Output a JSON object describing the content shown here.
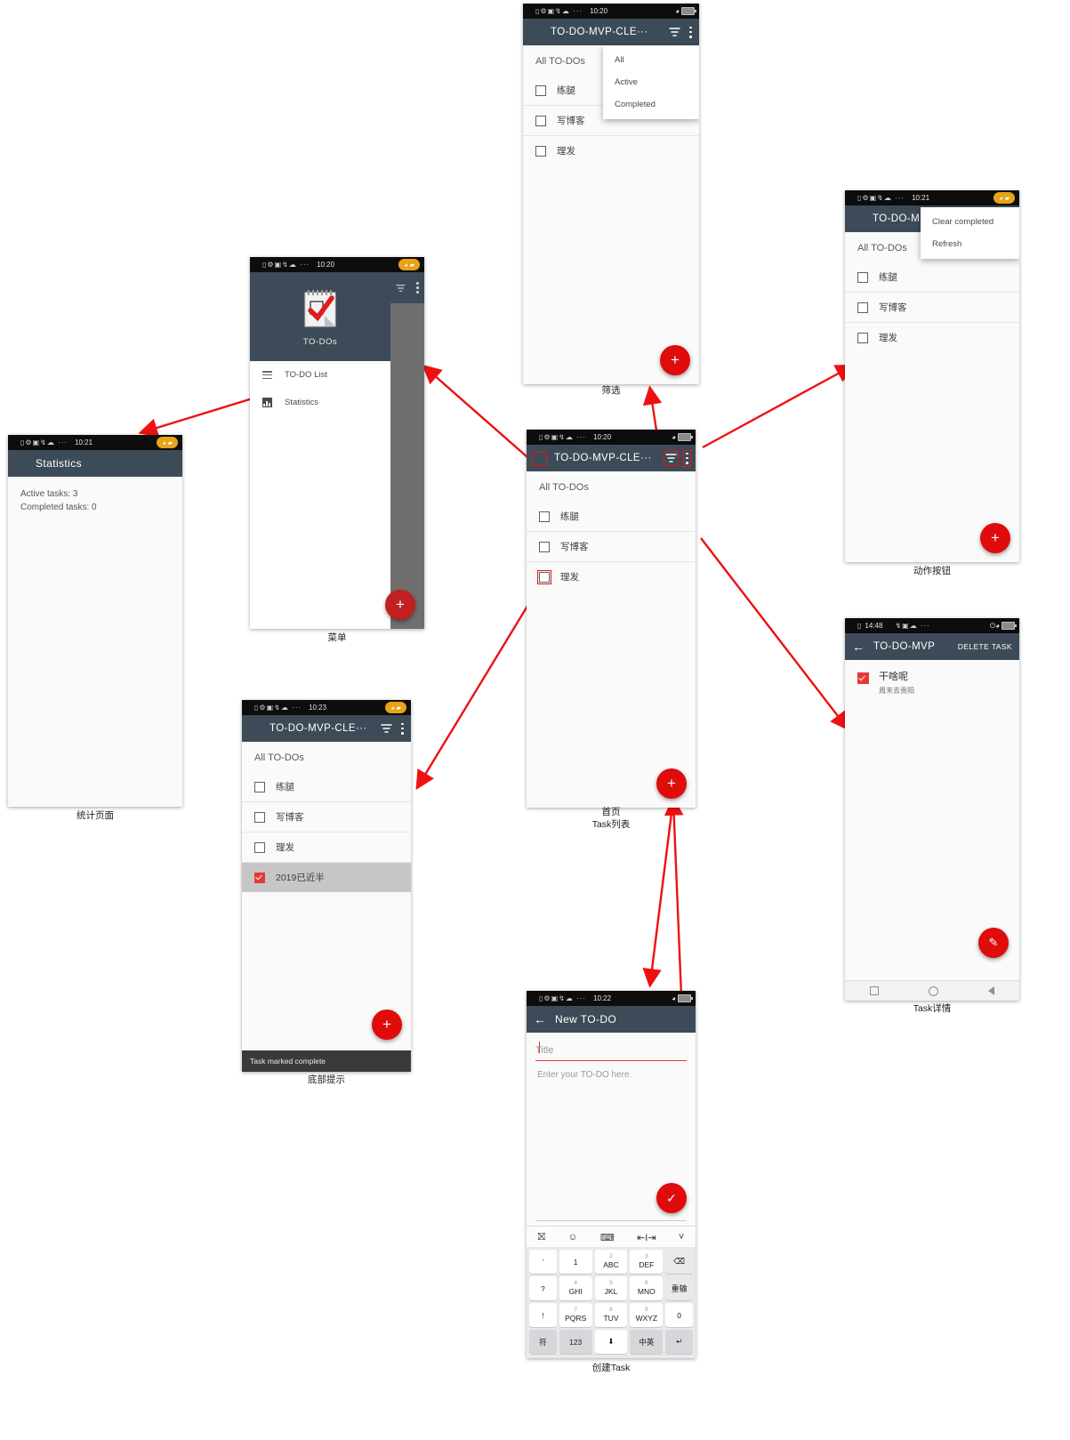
{
  "meta": {
    "accent_red": "#e00b0b",
    "appbar_color": "#3c4b57",
    "status_pill_color": "#e8a317"
  },
  "screens": {
    "filter": {
      "caption": "筛选",
      "status": {
        "time": "10:20"
      },
      "appbar": {
        "title": "TO-DO-MVP-CLE···",
        "menu_icon": "hamburger-icon",
        "filter_icon": "funnel-icon",
        "overflow_icon": "kebab-icon"
      },
      "section_title": "All TO-DOs",
      "tasks": [
        {
          "label": "练腿",
          "checked": false
        },
        {
          "label": "写博客",
          "checked": false
        },
        {
          "label": "理发",
          "checked": false
        }
      ],
      "popup": [
        "All",
        "Active",
        "Completed"
      ],
      "fab": "+"
    },
    "menu": {
      "caption": "菜单",
      "status": {
        "time": "10:20"
      },
      "drawer_label": "TO-DOs",
      "items": [
        {
          "label": "TO-DO List",
          "icon": "list-icon"
        },
        {
          "label": "Statistics",
          "icon": "bar-chart-icon"
        }
      ],
      "fab": "+"
    },
    "statistics": {
      "caption": "统计页面",
      "status": {
        "time": "10:21"
      },
      "appbar": {
        "title": "Statistics",
        "menu_icon": "hamburger-icon"
      },
      "lines": [
        "Active tasks: 3",
        "Completed tasks: 0"
      ]
    },
    "home": {
      "caption_line1": "首页",
      "caption_line2": "Task列表",
      "status": {
        "time": "10:20"
      },
      "appbar": {
        "title": "TO-DO-MVP-CLE···"
      },
      "section_title": "All TO-DOs",
      "tasks": [
        {
          "label": "练腿",
          "checked": false
        },
        {
          "label": "写博客",
          "checked": false
        },
        {
          "label": "理发",
          "checked": false
        }
      ],
      "fab": "+"
    },
    "actions": {
      "caption": "动作按钮",
      "status": {
        "time": "10:21"
      },
      "appbar": {
        "title": "TO-DO-M"
      },
      "section_title": "All TO-DOs",
      "tasks": [
        {
          "label": "练腿",
          "checked": false
        },
        {
          "label": "写博客",
          "checked": false
        },
        {
          "label": "理发",
          "checked": false
        }
      ],
      "popup": [
        "Clear completed",
        "Refresh"
      ],
      "fab": "+"
    },
    "toast": {
      "caption": "底部提示",
      "status": {
        "time": "10:23"
      },
      "appbar": {
        "title": "TO-DO-MVP-CLE···"
      },
      "section_title": "All TO-DOs",
      "tasks": [
        {
          "label": "练腿",
          "checked": false,
          "selected": false
        },
        {
          "label": "写博客",
          "checked": false,
          "selected": false
        },
        {
          "label": "理发",
          "checked": false,
          "selected": false
        },
        {
          "label": "2019已近半",
          "checked": true,
          "selected": true
        }
      ],
      "toast_text": "Task marked complete",
      "fab": "+"
    },
    "create": {
      "caption": "创建Task",
      "status": {
        "time": "10:22"
      },
      "appbar": {
        "title": "New TO-DO",
        "back_icon": "back-arrow-icon"
      },
      "title_placeholder": "Title",
      "description_placeholder": "Enter your TO-DO here.",
      "fab": "✓",
      "keyboard": {
        "toolbar_icons": [
          "sogou-icon",
          "emoji-icon",
          "keyboard-icon",
          "cursor-move-icon",
          "collapse-icon"
        ],
        "rows": [
          [
            {
              "sub": "",
              "main": "’"
            },
            {
              "sub": "",
              "main": "1"
            },
            {
              "sub": "2",
              "main": "ABC"
            },
            {
              "sub": "3",
              "main": "DEF"
            },
            {
              "sub": "",
              "main": "⌫"
            }
          ],
          [
            {
              "sub": "",
              "main": "?"
            },
            {
              "sub": "4",
              "main": "GHI"
            },
            {
              "sub": "5",
              "main": "JKL"
            },
            {
              "sub": "6",
              "main": "MNO"
            },
            {
              "sub": "",
              "main": "重输"
            }
          ],
          [
            {
              "sub": "",
              "main": "!"
            },
            {
              "sub": "7",
              "main": "PQRS"
            },
            {
              "sub": "8",
              "main": "TUV"
            },
            {
              "sub": "9",
              "main": "WXYZ"
            },
            {
              "sub": "",
              "main": "0"
            }
          ],
          [
            {
              "sub": "",
              "main": "符"
            },
            {
              "sub": "",
              "main": "123"
            },
            {
              "sub": "",
              "main": "⬇"
            },
            {
              "sub": "",
              "main": "中英"
            },
            {
              "sub": "",
              "main": "↵"
            }
          ]
        ]
      }
    },
    "detail": {
      "caption": "Task详情",
      "status": {
        "time": "14:48"
      },
      "appbar": {
        "title": "TO-DO-MVP",
        "action": "DELETE TASK",
        "back_icon": "back-arrow-icon"
      },
      "task": {
        "title": "干啥呢",
        "subtitle": "周末去贵阳",
        "checked": true
      },
      "fab": "✎",
      "navbar_icons": [
        "square-icon",
        "circle-icon",
        "triangle-back-icon"
      ]
    }
  }
}
